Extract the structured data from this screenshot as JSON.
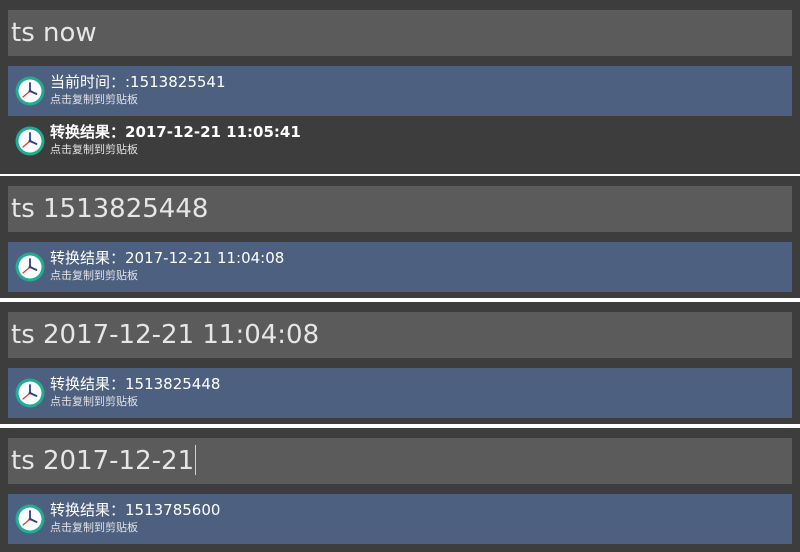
{
  "panels": [
    {
      "query": "ts now",
      "items": [
        {
          "title": "当前时间：:1513825541",
          "subtitle": "点击复制到剪贴板",
          "selected": true,
          "icon": "clock-icon"
        },
        {
          "title": "转换结果：2017-12-21 11:05:41",
          "subtitle": "点击复制到剪贴板",
          "selected": false,
          "icon": "clock-icon"
        }
      ]
    },
    {
      "query": "ts 1513825448",
      "items": [
        {
          "title": "转换结果：2017-12-21 11:04:08",
          "subtitle": "点击复制到剪贴板",
          "selected": true,
          "icon": "clock-icon"
        }
      ]
    },
    {
      "query": "ts 2017-12-21 11:04:08",
      "items": [
        {
          "title": "转换结果：1513825448",
          "subtitle": "点击复制到剪贴板",
          "selected": true,
          "icon": "clock-icon"
        }
      ]
    },
    {
      "query": "ts 2017-12-21",
      "items": [
        {
          "title": "转换结果：1513785600",
          "subtitle": "点击复制到剪贴板",
          "selected": true,
          "icon": "clock-icon"
        }
      ]
    }
  ],
  "colors": {
    "panel_bg": "#3d3d3d",
    "query_bg": "#5b5b5b",
    "selected_bg": "#4d6080",
    "icon_ring": "#1fae94",
    "separator": "#ffffff"
  }
}
